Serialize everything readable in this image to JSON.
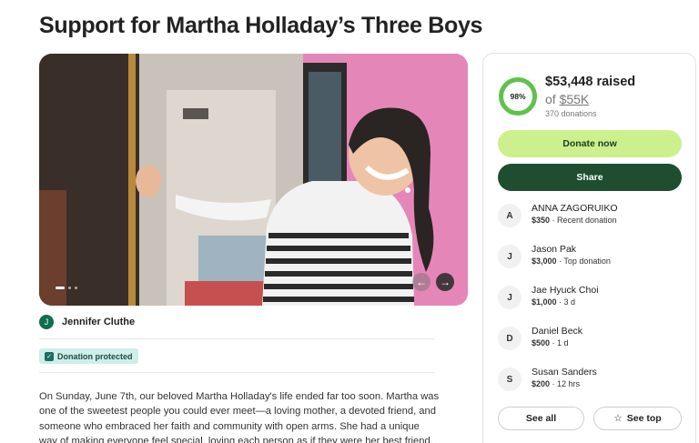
{
  "campaign": {
    "title": "Support for Martha Holladay’s Three Boys",
    "organizer_initial": "J",
    "organizer_name": "Jennifer Cluthe",
    "badge": "Donation protected",
    "story": "On Sunday, June 7th, our beloved Martha Holladay's life ended far too soon. Martha was one of the sweetest people you could ever meet—a loving mother, a devoted friend, and someone who embraced her faith and community with open arms. She had a unique way of making everyone feel special, loving each person as if they were her best friend. Her"
  },
  "carousel": {
    "slide_count": 3,
    "active_slide": 1,
    "prev_icon": "chevron-left-icon",
    "next_icon": "chevron-right-icon"
  },
  "progress": {
    "percent": 98,
    "percent_label": "98%",
    "raised": "$53,448 raised",
    "goal_prefix": "of",
    "goal": "$55K",
    "count": "370 donations"
  },
  "actions": {
    "donate": "Donate now",
    "share": "Share",
    "see_all": "See all",
    "see_top": "See top"
  },
  "donations": [
    {
      "initial": "A",
      "name": "ANNA ZAGORUIKO",
      "amount": "$350",
      "note": "Recent donation"
    },
    {
      "initial": "J",
      "name": "Jason Pak",
      "amount": "$3,000",
      "note": "Top donation"
    },
    {
      "initial": "J",
      "name": "Jae Hyuck Choi",
      "amount": "$1,000",
      "note": "3 d"
    },
    {
      "initial": "D",
      "name": "Daniel Beck",
      "amount": "$500",
      "note": "1 d"
    },
    {
      "initial": "S",
      "name": "Susan Sanders",
      "amount": "$200",
      "note": "12 hrs"
    }
  ],
  "colors": {
    "brand_green": "#1f4d2f",
    "donate_lime": "#cdf08f",
    "progress_green": "#5fc24a",
    "badge_teal": "#cdeee9"
  }
}
